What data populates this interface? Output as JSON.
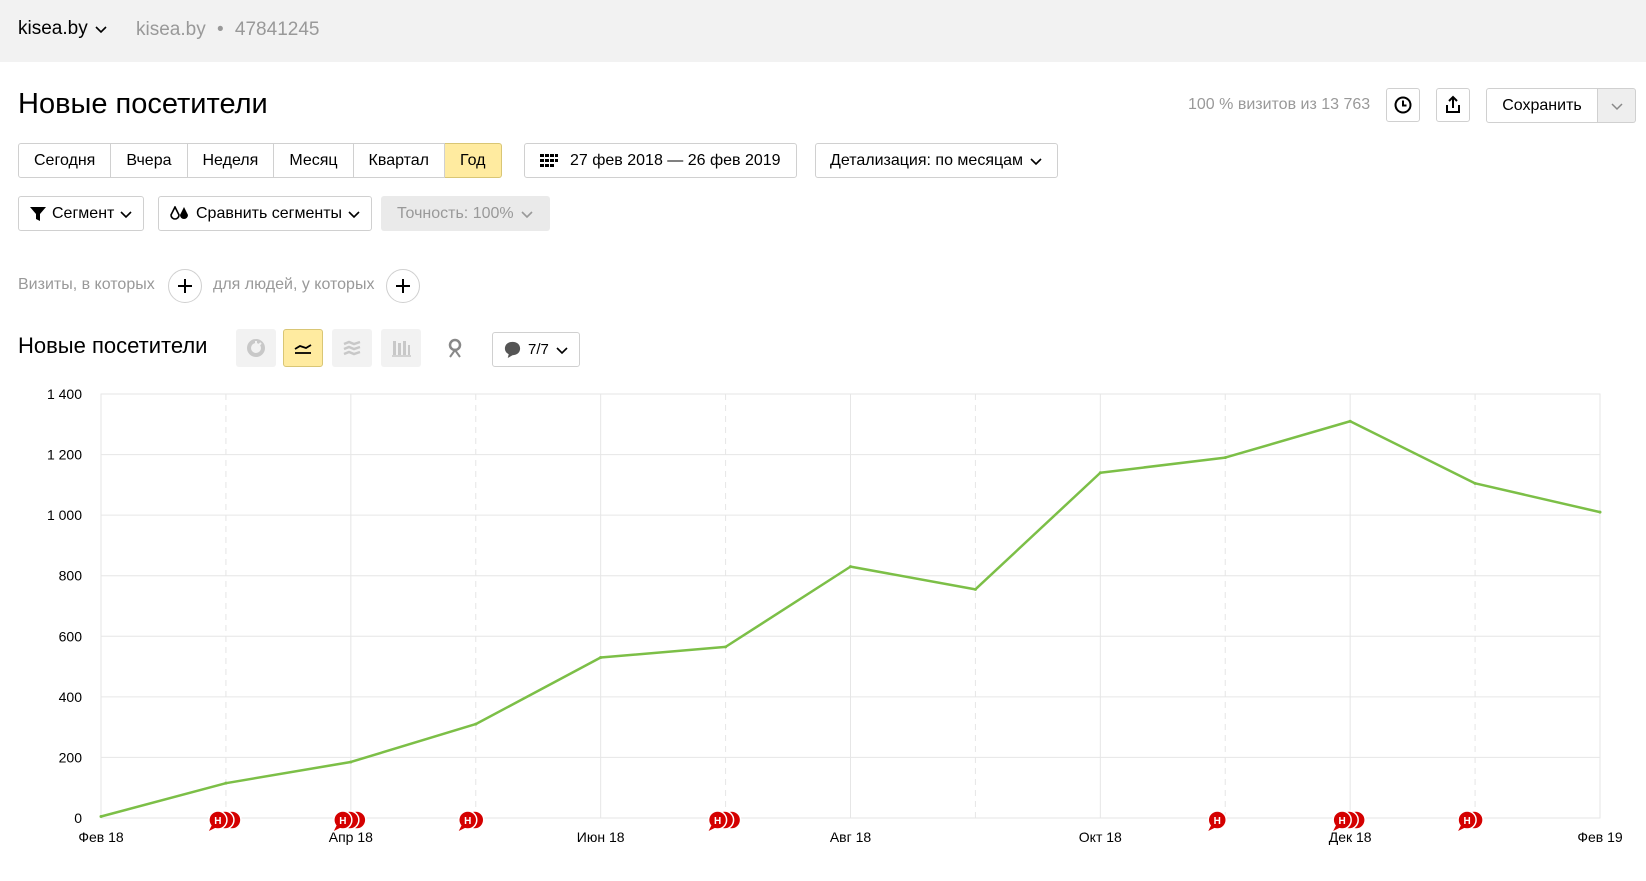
{
  "topbar": {
    "site": "kisea.by",
    "counter_site": "kisea.by",
    "counter_sep": "•",
    "counter_id": "47841245"
  },
  "page_title": "Новые посетители",
  "header": {
    "visits_summary": "100 % визитов из 13 763",
    "save_label": "Сохранить"
  },
  "periods": [
    {
      "label": "Сегодня",
      "active": false
    },
    {
      "label": "Вчера",
      "active": false
    },
    {
      "label": "Неделя",
      "active": false
    },
    {
      "label": "Месяц",
      "active": false
    },
    {
      "label": "Квартал",
      "active": false
    },
    {
      "label": "Год",
      "active": true
    }
  ],
  "date_range": "27 фев 2018 — 26 фев 2019",
  "detail": "Детализация: по месяцам",
  "segment_label": "Сегмент",
  "compare_label": "Сравнить сегменты",
  "accuracy_label": "Точность: 100%",
  "filters": {
    "visits_text": "Визиты, в которых",
    "people_text": "для людей, у которых"
  },
  "chart_section": {
    "title": "Новые посетители",
    "notes_count": "7/7"
  },
  "colors": {
    "line": "#7cbf47",
    "note": "#d40000",
    "active": "#ffeba0"
  },
  "chart_data": {
    "type": "line",
    "x": [
      "2018-02",
      "2018-03",
      "2018-04",
      "2018-05",
      "2018-06",
      "2018-07",
      "2018-08",
      "2018-09",
      "2018-10",
      "2018-11",
      "2018-12",
      "2019-01",
      "2019-02"
    ],
    "series": [
      {
        "values": [
          5,
          115,
          185,
          310,
          530,
          565,
          830,
          755,
          1140,
          1190,
          1310,
          1105,
          1010
        ]
      }
    ],
    "x_tick_labels": [
      {
        "month": "2018-02",
        "label": "Фев 18"
      },
      {
        "month": "2018-04",
        "label": "Апр 18"
      },
      {
        "month": "2018-06",
        "label": "Июн 18"
      },
      {
        "month": "2018-08",
        "label": "Авг 18"
      },
      {
        "month": "2018-10",
        "label": "Окт 18"
      },
      {
        "month": "2018-12",
        "label": "Дек 18"
      },
      {
        "month": "2019-02",
        "label": "Фев 19"
      }
    ],
    "y_ticks": [
      "0",
      "200",
      "400",
      "600",
      "800",
      "1 000",
      "1 200",
      "1 400"
    ],
    "ylim": [
      0,
      1400
    ],
    "notes": [
      {
        "month": "2018-03",
        "stack": 3,
        "letter": "Н"
      },
      {
        "month": "2018-04",
        "stack": 3,
        "letter": "Н"
      },
      {
        "month": "2018-05",
        "stack": 2,
        "letter": "Н"
      },
      {
        "month": "2018-07",
        "stack": 3,
        "letter": "Н"
      },
      {
        "month": "2018-11",
        "stack": 1,
        "letter": "Н"
      },
      {
        "month": "2018-12",
        "stack": 3,
        "letter": "Н"
      },
      {
        "month": "2019-01",
        "stack": 2,
        "letter": "Н"
      }
    ],
    "grid": true
  }
}
